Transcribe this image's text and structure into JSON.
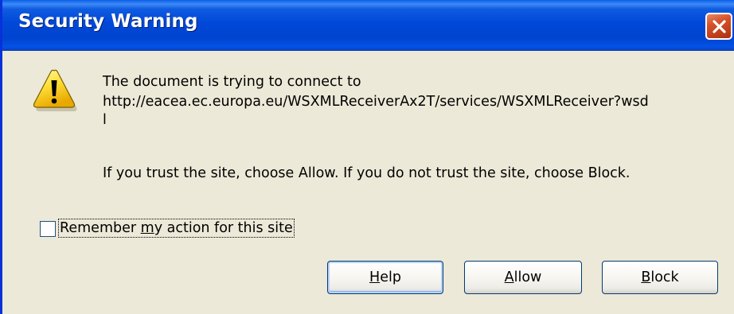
{
  "window": {
    "title": "Security Warning"
  },
  "icons": {
    "warning": "warning-icon",
    "close": "close-icon"
  },
  "message": {
    "line1": "The document is trying to connect to",
    "line2": "http://eacea.ec.europa.eu/WSXMLReceiverAx2T/services/WSXMLReceiver?wsd",
    "line3": "l",
    "line4": "If you trust the site, choose Allow. If you do not trust the site, choose Block."
  },
  "remember": {
    "checked": false,
    "label_pre": "Remember ",
    "label_ul": "m",
    "label_post": "y action for this site"
  },
  "buttons": {
    "help": {
      "ul": "H",
      "rest": "elp"
    },
    "allow": {
      "ul": "A",
      "rest": "llow"
    },
    "block": {
      "ul": "B",
      "rest": "lock"
    }
  },
  "colors": {
    "titlebar": "#0048D8",
    "dialog_bg": "#ECE9D8",
    "close": "#D6522A",
    "button_border": "#003C74"
  }
}
